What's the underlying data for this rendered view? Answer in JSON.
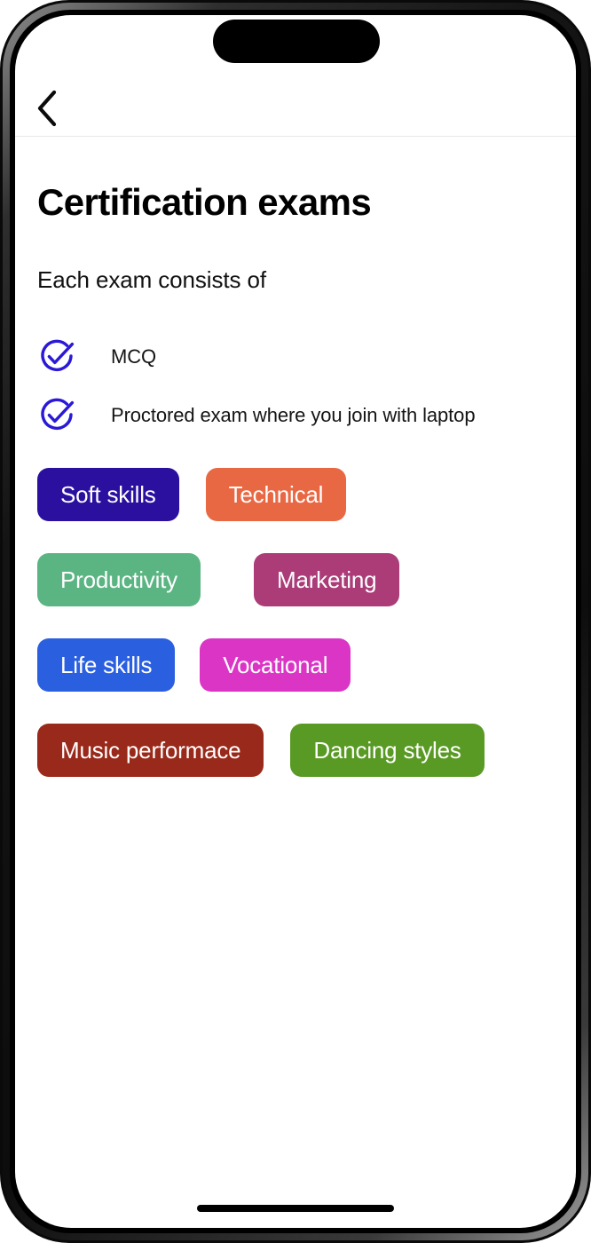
{
  "device": {
    "dynamic_island": "dynamic-island",
    "home_indicator": "home-indicator"
  },
  "nav": {
    "back_icon": "chevron-left-icon",
    "back_label": "Back"
  },
  "header": {
    "title": "Certification exams",
    "subtitle": "Each exam consists of"
  },
  "checklist": {
    "icon_name": "circle-check-icon",
    "icon_color": "#2A19D6",
    "items": [
      {
        "label": "MCQ"
      },
      {
        "label": "Proctored exam where you join with laptop"
      }
    ]
  },
  "tags": {
    "rows": [
      [
        {
          "label": "Soft skills",
          "color": "#2B10A0",
          "text_color": "#ffffff"
        },
        {
          "label": "Technical",
          "color": "#E96844",
          "text_color": "#ffffff"
        }
      ],
      [
        {
          "label": "Productivity",
          "color": "#5BB583",
          "text_color": "#ffffff"
        },
        {
          "label": "Marketing",
          "color": "#AB3C78",
          "text_color": "#ffffff"
        }
      ],
      [
        {
          "label": "Life skills",
          "color": "#2A5FE0",
          "text_color": "#ffffff"
        },
        {
          "label": "Vocational",
          "color": "#DB35C6",
          "text_color": "#ffffff"
        }
      ],
      [
        {
          "label": "Music performace",
          "color": "#99291A",
          "text_color": "#ffffff"
        },
        {
          "label": "Dancing styles",
          "color": "#599A24",
          "text_color": "#ffffff"
        }
      ]
    ]
  },
  "tag_geometry": {
    "row_offsets": [
      0,
      0,
      0,
      0
    ],
    "gaps": [
      30,
      60,
      28,
      30
    ]
  }
}
